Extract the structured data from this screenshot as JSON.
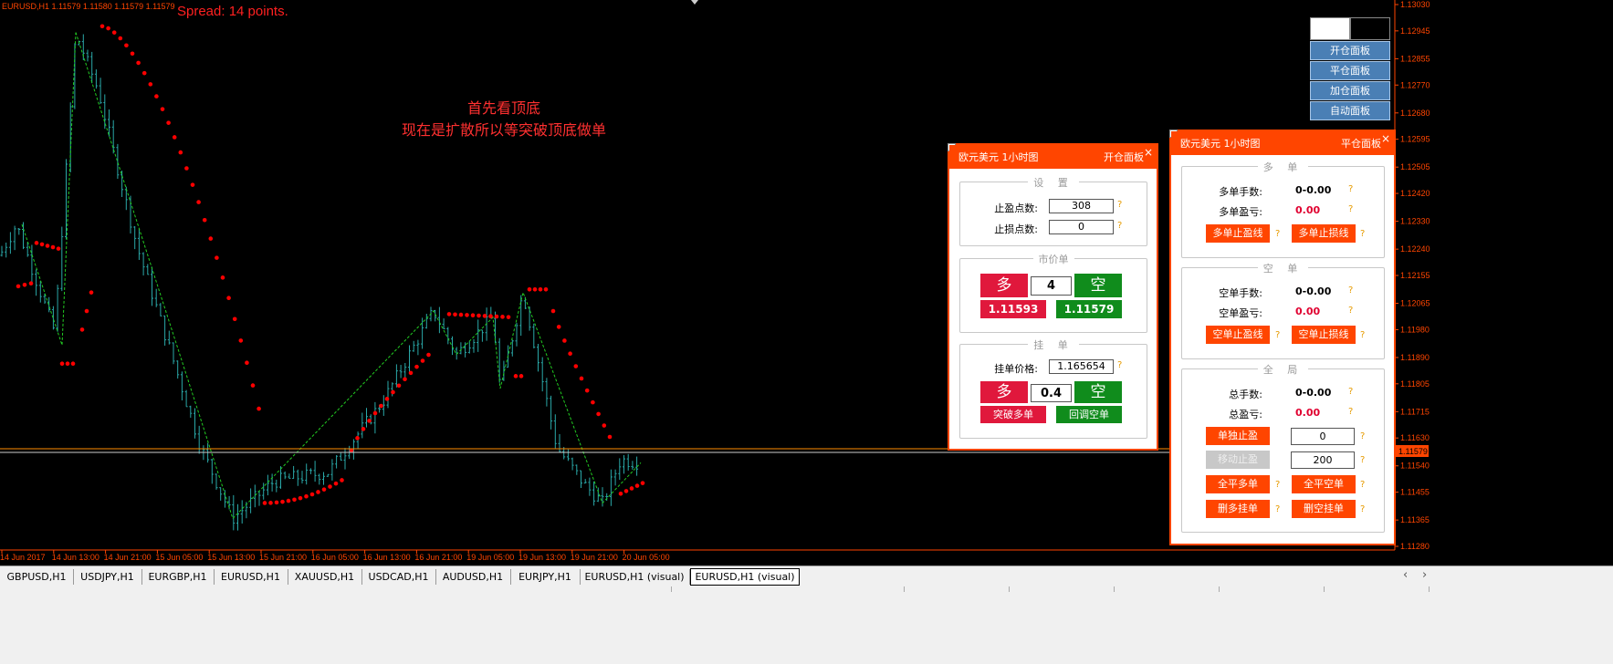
{
  "chart": {
    "info_line": "EURUSD,H1  1.11579 1.11580 1.11579 1.11579",
    "spread_text": "Spread: 14 points.",
    "annotation_line1": "首先看顶底",
    "annotation_line2": "现在是扩散所以等突破顶底做单",
    "price_labels": [
      "1.13030",
      "1.12945",
      "1.12855",
      "1.12770",
      "1.12680",
      "1.12595",
      "1.12505",
      "1.12420",
      "1.12330",
      "1.12240",
      "1.12155",
      "1.12065",
      "1.11980",
      "1.11890",
      "1.11805",
      "1.11715",
      "1.11630",
      "1.11540",
      "1.11455",
      "1.11365",
      "1.11280"
    ],
    "current_price_tag": "1.11579",
    "time_labels": [
      "14 Jun 2017",
      "14 Jun 13:00",
      "14 Jun 21:00",
      "15 Jun 05:00",
      "15 Jun 13:00",
      "15 Jun 21:00",
      "16 Jun 05:00",
      "16 Jun 13:00",
      "16 Jun 21:00",
      "19 Jun 05:00",
      "19 Jun 13:00",
      "19 Jun 21:00",
      "20 Jun 05:00"
    ],
    "colors": {
      "candles": "#2aa8a8",
      "sar": "#ff0000",
      "zigzag": "#22cc22",
      "axis": "#ff4500",
      "price_line": "#ff8c00"
    }
  },
  "chart_data": {
    "type": "candlestick",
    "symbol": "EURUSD",
    "timeframe": "H1",
    "ylim": [
      1.1128,
      1.1303
    ],
    "x": [
      "14 Jun 2017",
      "14 Jun 13:00",
      "14 Jun 21:00",
      "15 Jun 05:00",
      "15 Jun 13:00",
      "15 Jun 21:00",
      "16 Jun 05:00",
      "16 Jun 13:00",
      "16 Jun 21:00",
      "19 Jun 05:00",
      "19 Jun 13:00",
      "19 Jun 21:00",
      "20 Jun 05:00"
    ],
    "close_approx": [
      1.122,
      1.129,
      1.1225,
      1.121,
      1.116,
      1.115,
      1.114,
      1.118,
      1.12,
      1.1195,
      1.12,
      1.115,
      1.1155
    ],
    "current_price": 1.11579,
    "series": [
      {
        "name": "Parabolic SAR",
        "type": "scatter"
      },
      {
        "name": "ZigZag",
        "type": "line"
      }
    ]
  },
  "nav": {
    "blank1": "",
    "blank2": "",
    "buttons": [
      "开仓面板",
      "平仓面板",
      "加仓面板",
      "自动面板"
    ]
  },
  "open_panel": {
    "title_left": "欧元美元 1小时图",
    "title_right": "开仓面板",
    "close": "×",
    "settings": {
      "title": "设 置",
      "tp_label": "止盈点数:",
      "tp_value": "308",
      "sl_label": "止损点数:",
      "sl_value": "0",
      "help": "?"
    },
    "market": {
      "title": "市价单",
      "buy": "多",
      "lots": "4",
      "sell": "空",
      "buy_price": "1.11593",
      "sell_price": "1.11579"
    },
    "pending": {
      "title": "挂 单",
      "price_label": "挂单价格:",
      "price_value": "1.165654",
      "buy": "多",
      "lots": "0.4",
      "sell": "空",
      "breakout_buy": "突破多单",
      "pullback_sell": "回调空单"
    }
  },
  "close_panel": {
    "title_left": "欧元美元 1小时图",
    "title_right": "平仓面板",
    "close": "×",
    "long": {
      "title": "多 单",
      "lots_label": "多单手数:",
      "lots_value": "0-0.00",
      "pnl_label": "多单盈亏:",
      "pnl_value": "0.00",
      "tp_line": "多单止盈线",
      "sl_line": "多单止损线"
    },
    "short": {
      "title": "空 单",
      "lots_label": "空单手数:",
      "lots_value": "0-0.00",
      "pnl_label": "空单盈亏:",
      "pnl_value": "0.00",
      "tp_line": "空单止盈线",
      "sl_line": "空单止损线"
    },
    "global": {
      "title": "全 局",
      "lots_label": "总手数:",
      "lots_value": "0-0.00",
      "pnl_label": "总盈亏:",
      "pnl_value": "0.00",
      "single_tp": "单独止盈",
      "single_tp_value": "0",
      "trailing": "移动止盈",
      "trailing_value": "200",
      "close_all_long": "全平多单",
      "close_all_short": "全平空单",
      "del_long_pending": "删多挂单",
      "del_short_pending": "删空挂单"
    }
  },
  "tabs": [
    "GBPUSD,H1",
    "USDJPY,H1",
    "EURGBP,H1",
    "EURUSD,H1",
    "XAUUSD,H1",
    "USDCAD,H1",
    "AUDUSD,H1",
    "EURJPY,H1",
    "EURUSD,H1 (visual)",
    "EURUSD,H1 (visual)"
  ],
  "tab_scroll": {
    "left": "‹",
    "right": "›"
  }
}
